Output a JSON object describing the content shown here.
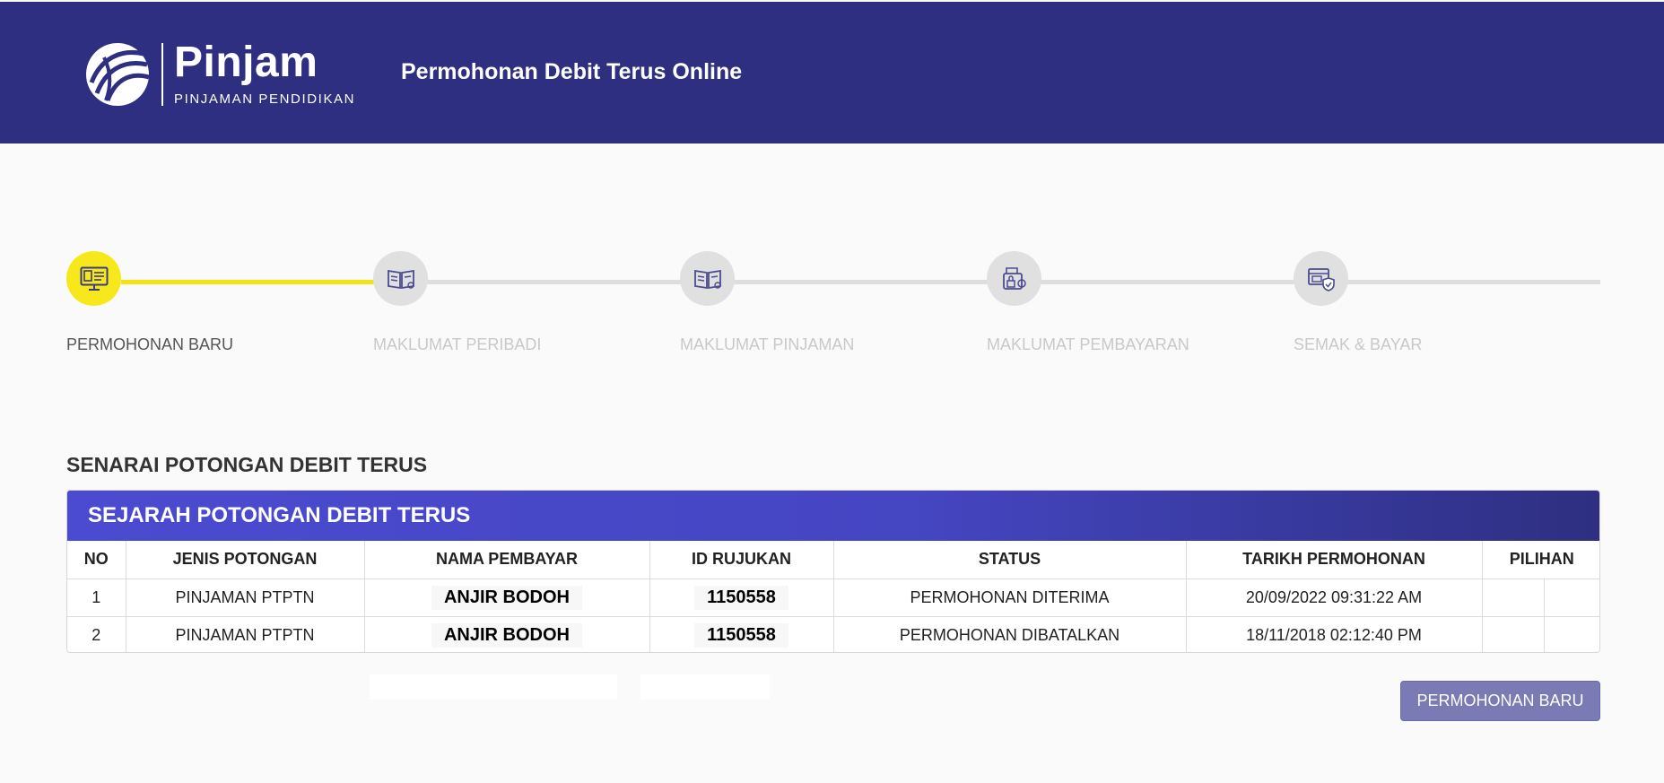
{
  "header": {
    "brand_name": "Pinjam",
    "brand_sub": "PINJAMAN PENDIDIKAN",
    "title": "Permohonan Debit Terus Online",
    "bg_color": "#2e2f81"
  },
  "stepper": {
    "active_color": "#f6e81b",
    "steps": [
      {
        "label": "PERMOHONAN BARU",
        "icon": "computer-form-icon",
        "active": true
      },
      {
        "label": "MAKLUMAT PERIBADI",
        "icon": "open-book-icon",
        "active": false
      },
      {
        "label": "MAKLUMAT PINJAMAN",
        "icon": "open-book-icon",
        "active": false
      },
      {
        "label": "MAKLUMAT PEMBAYARAN",
        "icon": "wallet-lock-icon",
        "active": false
      },
      {
        "label": "SEMAK & BAYAR",
        "icon": "payment-shield-icon",
        "active": false
      }
    ]
  },
  "section_title": "SENARAI POTONGAN DEBIT TERUS",
  "history": {
    "title": "SEJARAH POTONGAN DEBIT TERUS",
    "columns": [
      "NO",
      "JENIS POTONGAN",
      "NAMA PEMBAYAR",
      "ID RUJUKAN",
      "STATUS",
      "TARIKH PERMOHONAN",
      "PILIHAN"
    ],
    "rows": [
      {
        "no": "1",
        "jenis": "PINJAMAN PTPTN",
        "nama": "ANJIR BODOH",
        "id": "1150558",
        "status": "PERMOHONAN DITERIMA",
        "tarikh": "20/09/2022 09:31:22 AM"
      },
      {
        "no": "2",
        "jenis": "PINJAMAN PTPTN",
        "nama": "ANJIR BODOH",
        "id": "1150558",
        "status": "PERMOHONAN DIBATALKAN",
        "tarikh": "18/11/2018 02:12:40 PM"
      }
    ]
  },
  "actions": {
    "new_application_label": "PERMOHONAN BARU",
    "button_color": "#7a7ab4"
  }
}
